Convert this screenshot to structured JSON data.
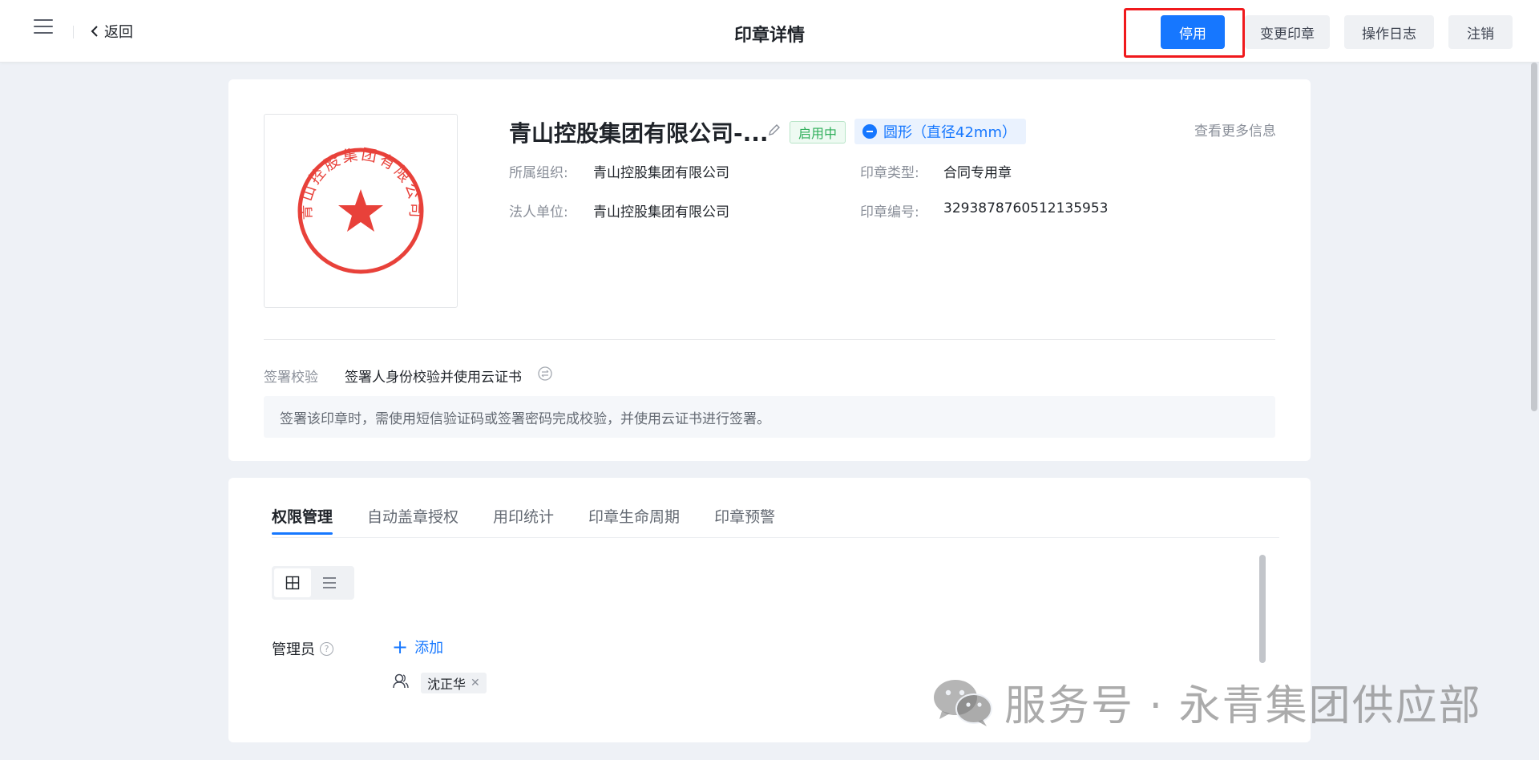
{
  "header": {
    "back_label": "返回",
    "title": "印章详情",
    "buttons": {
      "disable": "停用",
      "change_seal": "变更印章",
      "operation_log": "操作日志",
      "revoke": "注销"
    }
  },
  "seal": {
    "name": "青山控股集团有限公司-...",
    "image_text": "青山控股集团有限公司",
    "status": "启用中",
    "shape": "圆形（直径42mm）",
    "more_info": "查看更多信息",
    "fields": {
      "org_label": "所属组织:",
      "org_value": "青山控股集团有限公司",
      "legal_label": "法人单位:",
      "legal_value": "青山控股集团有限公司",
      "type_label": "印章类型:",
      "type_value": "合同专用章",
      "number_label": "印章编号:",
      "number_value": "3293878760512135953"
    },
    "verification": {
      "label": "签署校验",
      "value": "签署人身份校验并使用云证书",
      "description": "签署该印章时，需使用短信验证码或签署密码完成校验，并使用云证书进行签署。"
    }
  },
  "tabs": [
    {
      "label": "权限管理",
      "active": true
    },
    {
      "label": "自动盖章授权",
      "active": false
    },
    {
      "label": "用印统计",
      "active": false
    },
    {
      "label": "印章生命周期",
      "active": false
    },
    {
      "label": "印章预警",
      "active": false
    }
  ],
  "permissions": {
    "admin_label": "管理员",
    "help_symbol": "?",
    "add_label": "添加",
    "users": [
      "沈正华"
    ]
  },
  "watermark": {
    "text": "服务号 · 永青集团供应部"
  },
  "colors": {
    "primary": "#1677ff",
    "highlight": "#f0191c",
    "seal_red": "#e8413a",
    "status_green": "#2fae5a"
  }
}
